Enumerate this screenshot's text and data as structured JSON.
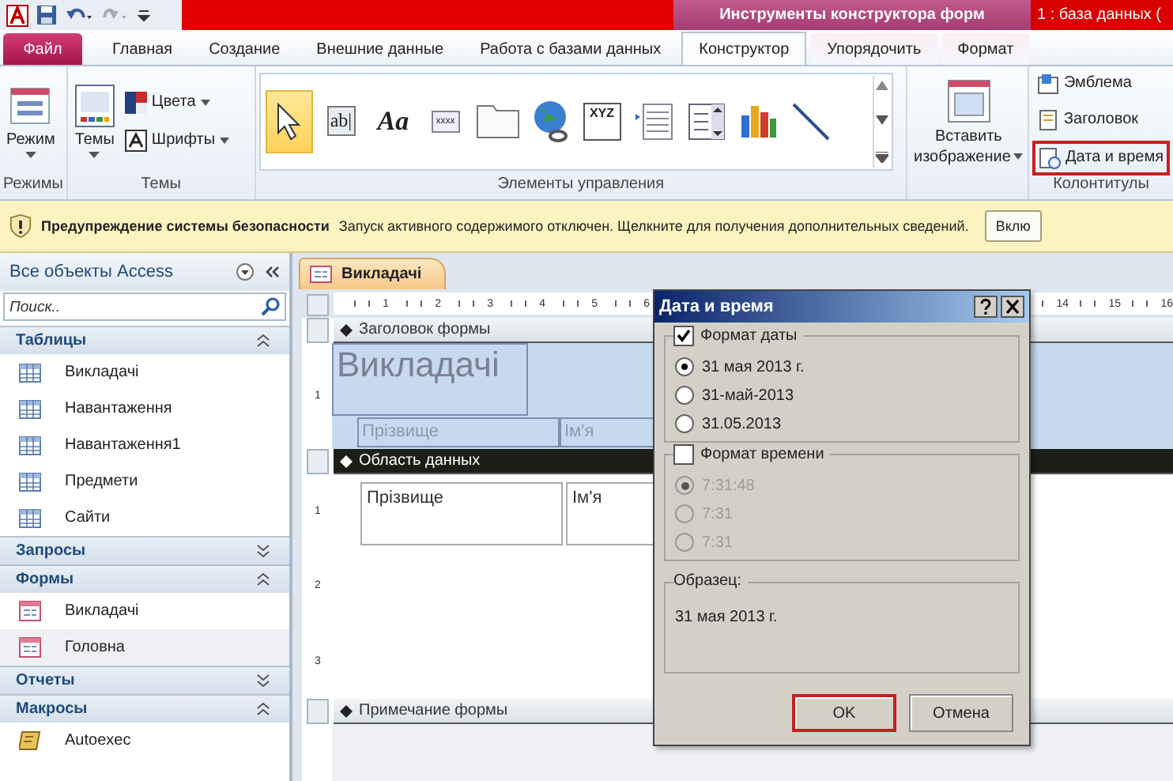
{
  "title_bar": {
    "context_title": "Инструменты конструктора форм",
    "app_title": "1 : база данных ("
  },
  "ribbon_tabs": [
    {
      "label": "Файл",
      "kind": "file",
      "selected": false
    },
    {
      "label": "Главная",
      "kind": "tab",
      "selected": false
    },
    {
      "label": "Создание",
      "kind": "tab",
      "selected": false
    },
    {
      "label": "Внешние данные",
      "kind": "tab",
      "selected": false
    },
    {
      "label": "Работа с базами данных",
      "kind": "tab",
      "selected": false
    },
    {
      "label": "Конструктор",
      "kind": "context",
      "selected": true
    },
    {
      "label": "Упорядочить",
      "kind": "context",
      "selected": false
    },
    {
      "label": "Формат",
      "kind": "context",
      "selected": false
    }
  ],
  "ribbon": {
    "modes": {
      "button": "Режим",
      "group_label": "Режимы"
    },
    "themes": {
      "button": "Темы",
      "colors": "Цвета",
      "fonts": "Шрифты",
      "group_label": "Темы"
    },
    "controls": {
      "group_label": "Элементы управления",
      "items": [
        {
          "kind": "pointer",
          "selected": true
        },
        {
          "kind": "textbox",
          "glyph": "ab|",
          "selected": false
        },
        {
          "kind": "label",
          "glyph": "Aa",
          "selected": false
        },
        {
          "kind": "button",
          "glyph": "xxxx",
          "selected": false
        },
        {
          "kind": "tab",
          "selected": false
        },
        {
          "kind": "hyperlink",
          "selected": false
        },
        {
          "kind": "frame",
          "glyph": "XYZ",
          "selected": false
        },
        {
          "kind": "list",
          "selected": false
        },
        {
          "kind": "combo",
          "selected": false
        },
        {
          "kind": "chart",
          "selected": false
        },
        {
          "kind": "line",
          "selected": false
        }
      ]
    },
    "insert_image": {
      "line1": "Вставить",
      "line2": "изображение"
    },
    "header_footer": {
      "group_label": "Колонтитулы",
      "items": [
        {
          "label": "Эмблема",
          "kind": "logo",
          "highlighted": false
        },
        {
          "label": "Заголовок",
          "kind": "title",
          "highlighted": false
        },
        {
          "label": "Дата и время",
          "kind": "datetime",
          "highlighted": true
        }
      ]
    }
  },
  "security_bar": {
    "title": "Предупреждение системы безопасности",
    "message": "Запуск активного содержимого отключен. Щелкните для получения дополнительных сведений.",
    "button": "Вклю"
  },
  "nav_pane": {
    "title": "Все объекты Access",
    "search_placeholder": "Поиск..",
    "groups": [
      {
        "label": "Таблицы",
        "expanded": true,
        "items": [
          {
            "label": "Викладачі",
            "kind": "table",
            "selected": false
          },
          {
            "label": "Навантаження",
            "kind": "table",
            "selected": false
          },
          {
            "label": "Навантаження1",
            "kind": "table",
            "selected": false
          },
          {
            "label": "Предмети",
            "kind": "table",
            "selected": false
          },
          {
            "label": "Сайти",
            "kind": "table",
            "selected": false
          }
        ]
      },
      {
        "label": "Запросы",
        "expanded": false
      },
      {
        "label": "Формы",
        "expanded": true,
        "items": [
          {
            "label": "Викладачі",
            "kind": "form",
            "selected": false
          },
          {
            "label": "Головна",
            "kind": "form",
            "selected": true
          }
        ]
      },
      {
        "label": "Отчеты",
        "expanded": false
      },
      {
        "label": "Макросы",
        "expanded": true,
        "items": [
          {
            "label": "Autoexec",
            "kind": "macro",
            "selected": false
          }
        ]
      }
    ]
  },
  "document_tab": {
    "label": "Викладачі"
  },
  "ruler": {
    "left_labels": [
      "1",
      "2",
      "3",
      "4",
      "5",
      "6"
    ],
    "right_labels": [
      "14",
      "15",
      "16"
    ]
  },
  "form_design": {
    "sections": [
      {
        "label": "Заголовок формы",
        "kind": "header",
        "selected": false,
        "ruler_labels": [
          "1"
        ]
      },
      {
        "label": "Область данных",
        "kind": "detail",
        "selected": true,
        "ruler_labels": [
          "1",
          "2",
          "3"
        ]
      },
      {
        "label": "Примечание формы",
        "kind": "footer",
        "selected": false
      }
    ],
    "title_label": "Викладачі",
    "header_labels": [
      "Прізвище",
      "Ім'я"
    ],
    "detail_fields": [
      "Прізвище",
      "Ім'я"
    ]
  },
  "dialog": {
    "title": "Дата и время",
    "date_format": {
      "label": "Формат даты",
      "checked": true,
      "options": [
        {
          "label": "31 мая 2013 г.",
          "selected": true
        },
        {
          "label": "31-май-2013",
          "selected": false
        },
        {
          "label": "31.05.2013",
          "selected": false
        }
      ]
    },
    "time_format": {
      "label": "Формат времени",
      "checked": false,
      "options": [
        {
          "label": "7:31:48",
          "selected": true
        },
        {
          "label": "7:31",
          "selected": false
        },
        {
          "label": "7:31",
          "selected": false
        }
      ]
    },
    "sample": {
      "label": "Образец:",
      "value": "31 мая 2013 г."
    },
    "buttons": [
      {
        "label": "OK",
        "focused": true
      },
      {
        "label": "Отмена",
        "focused": false
      }
    ]
  }
}
